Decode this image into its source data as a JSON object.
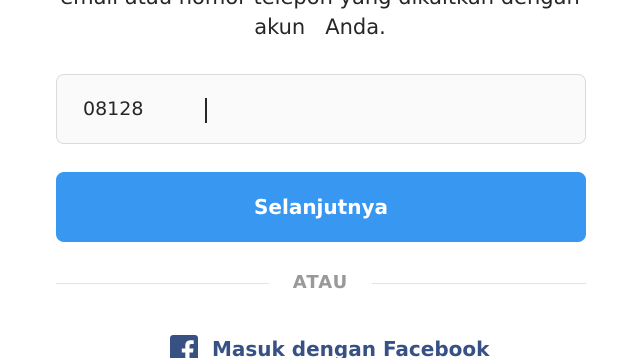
{
  "instruction": {
    "line1": "email atau nomor telepon yang dikaitkan dengan",
    "line2": "akun   Anda."
  },
  "phone_field": {
    "value": "08128"
  },
  "next_button": {
    "label": "Selanjutnya"
  },
  "divider": {
    "label": "ATAU"
  },
  "facebook_login": {
    "label": "Masuk dengan Facebook",
    "icon": "facebook-icon"
  },
  "colors": {
    "primary_button": "#3897f0",
    "facebook_blue": "#385185",
    "divider_text": "#999999"
  }
}
